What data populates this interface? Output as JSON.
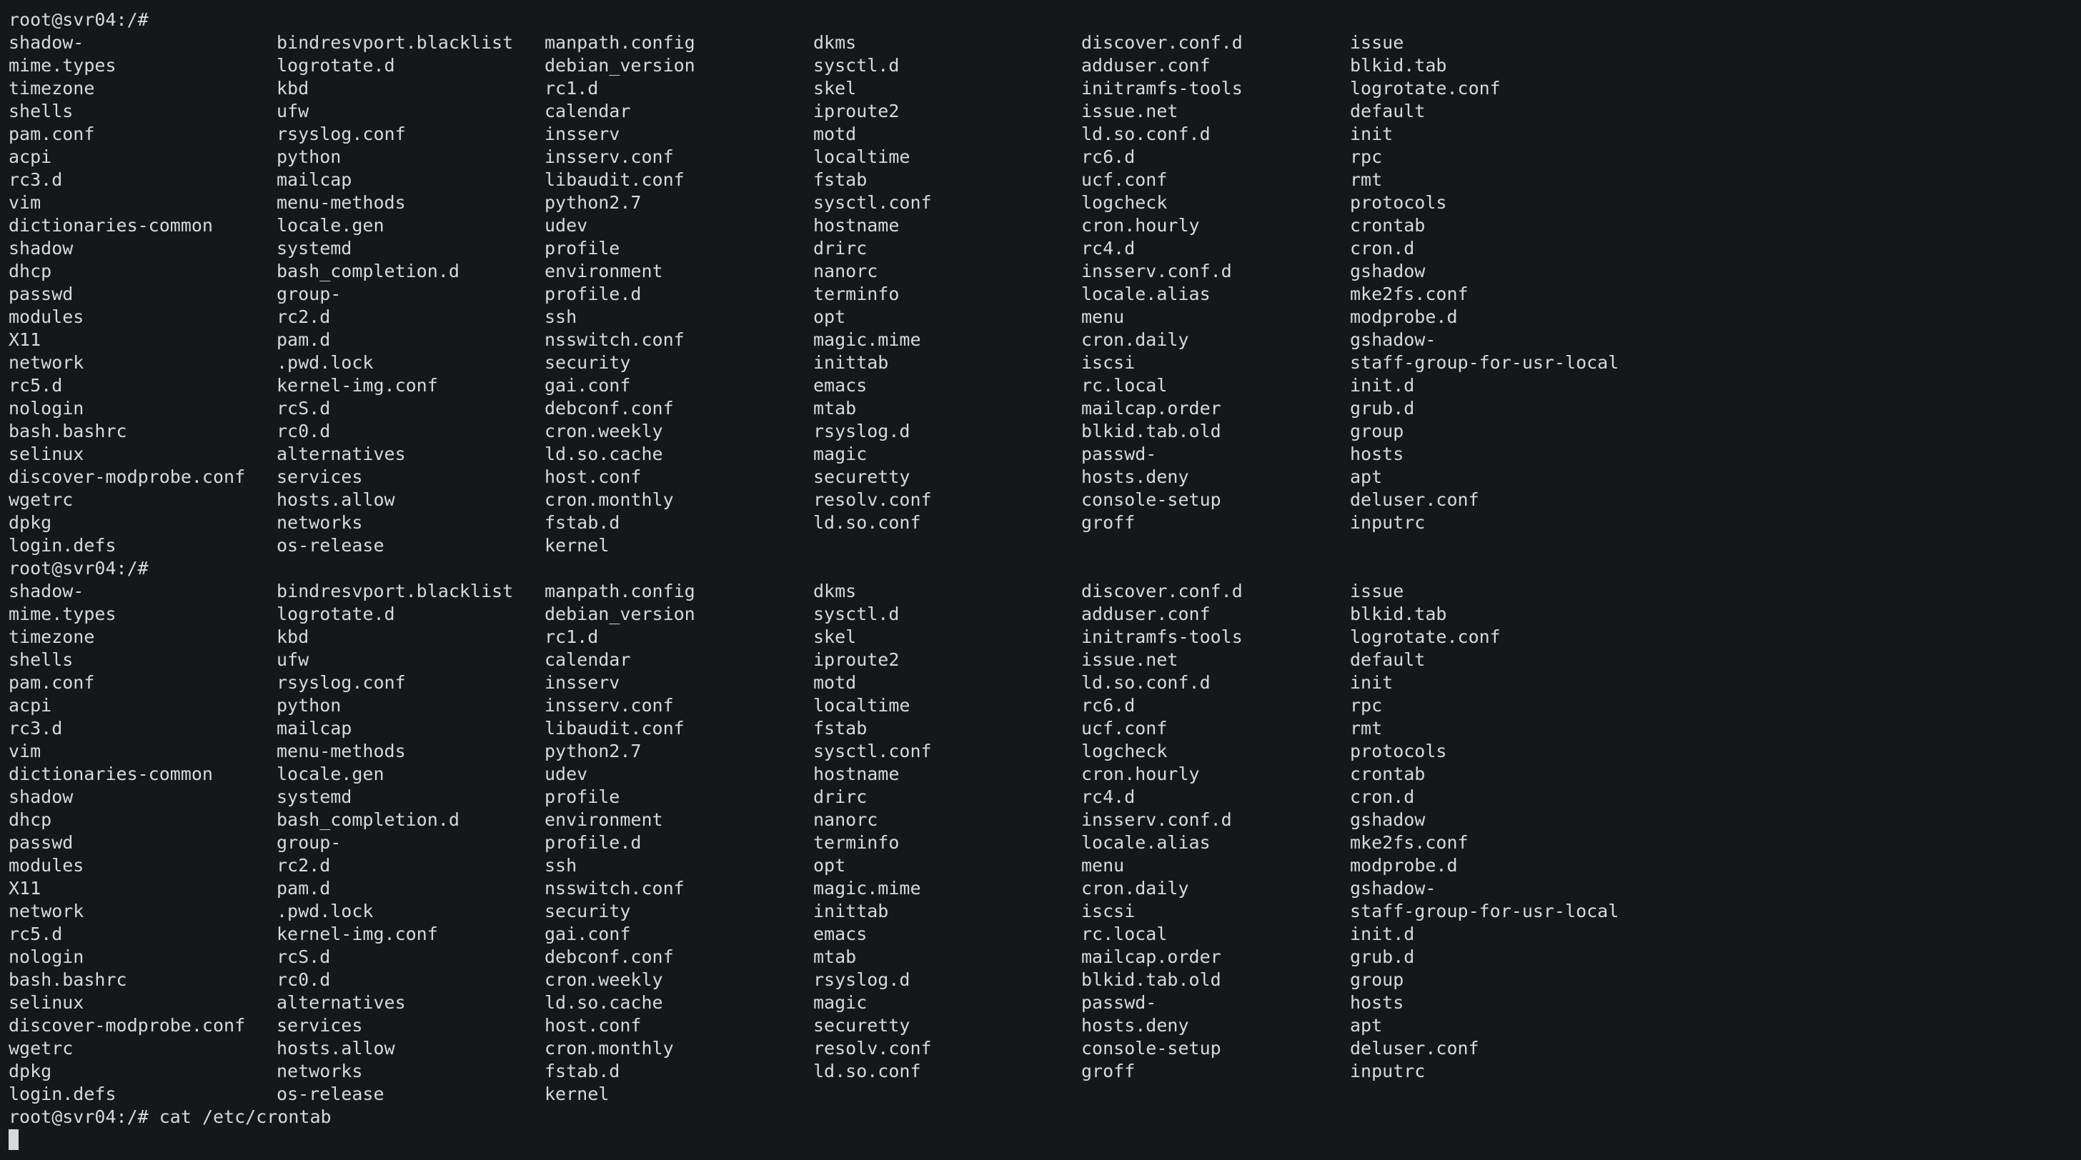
{
  "terminal": {
    "prompt": "root@svr04:/#",
    "last_command": "cat /etc/crontab",
    "listing_rows": [
      [
        "shadow-",
        "bindresvport.blacklist",
        "manpath.config",
        "dkms",
        "discover.conf.d",
        "issue"
      ],
      [
        "mime.types",
        "logrotate.d",
        "debian_version",
        "sysctl.d",
        "adduser.conf",
        "blkid.tab"
      ],
      [
        "timezone",
        "kbd",
        "rc1.d",
        "skel",
        "initramfs-tools",
        "logrotate.conf"
      ],
      [
        "shells",
        "ufw",
        "calendar",
        "iproute2",
        "issue.net",
        "default"
      ],
      [
        "pam.conf",
        "rsyslog.conf",
        "insserv",
        "motd",
        "ld.so.conf.d",
        "init"
      ],
      [
        "acpi",
        "python",
        "insserv.conf",
        "localtime",
        "rc6.d",
        "rpc"
      ],
      [
        "rc3.d",
        "mailcap",
        "libaudit.conf",
        "fstab",
        "ucf.conf",
        "rmt"
      ],
      [
        "vim",
        "menu-methods",
        "python2.7",
        "sysctl.conf",
        "logcheck",
        "protocols"
      ],
      [
        "dictionaries-common",
        "locale.gen",
        "udev",
        "hostname",
        "cron.hourly",
        "crontab"
      ],
      [
        "shadow",
        "systemd",
        "profile",
        "drirc",
        "rc4.d",
        "cron.d"
      ],
      [
        "dhcp",
        "bash_completion.d",
        "environment",
        "nanorc",
        "insserv.conf.d",
        "gshadow"
      ],
      [
        "passwd",
        "group-",
        "profile.d",
        "terminfo",
        "locale.alias",
        "mke2fs.conf"
      ],
      [
        "modules",
        "rc2.d",
        "ssh",
        "opt",
        "menu",
        "modprobe.d"
      ],
      [
        "X11",
        "pam.d",
        "nsswitch.conf",
        "magic.mime",
        "cron.daily",
        "gshadow-"
      ],
      [
        "network",
        ".pwd.lock",
        "security",
        "inittab",
        "iscsi",
        "staff-group-for-usr-local"
      ],
      [
        "rc5.d",
        "kernel-img.conf",
        "gai.conf",
        "emacs",
        "rc.local",
        "init.d"
      ],
      [
        "nologin",
        "rcS.d",
        "debconf.conf",
        "mtab",
        "mailcap.order",
        "grub.d"
      ],
      [
        "bash.bashrc",
        "rc0.d",
        "cron.weekly",
        "rsyslog.d",
        "blkid.tab.old",
        "group"
      ],
      [
        "selinux",
        "alternatives",
        "ld.so.cache",
        "magic",
        "passwd-",
        "hosts"
      ],
      [
        "discover-modprobe.conf",
        "services",
        "host.conf",
        "securetty",
        "hosts.deny",
        "apt"
      ],
      [
        "wgetrc",
        "hosts.allow",
        "cron.monthly",
        "resolv.conf",
        "console-setup",
        "deluser.conf"
      ],
      [
        "dpkg",
        "networks",
        "fstab.d",
        "ld.so.conf",
        "groff",
        "inputrc"
      ],
      [
        "login.defs",
        "os-release",
        "kernel",
        "",
        "",
        ""
      ]
    ]
  }
}
